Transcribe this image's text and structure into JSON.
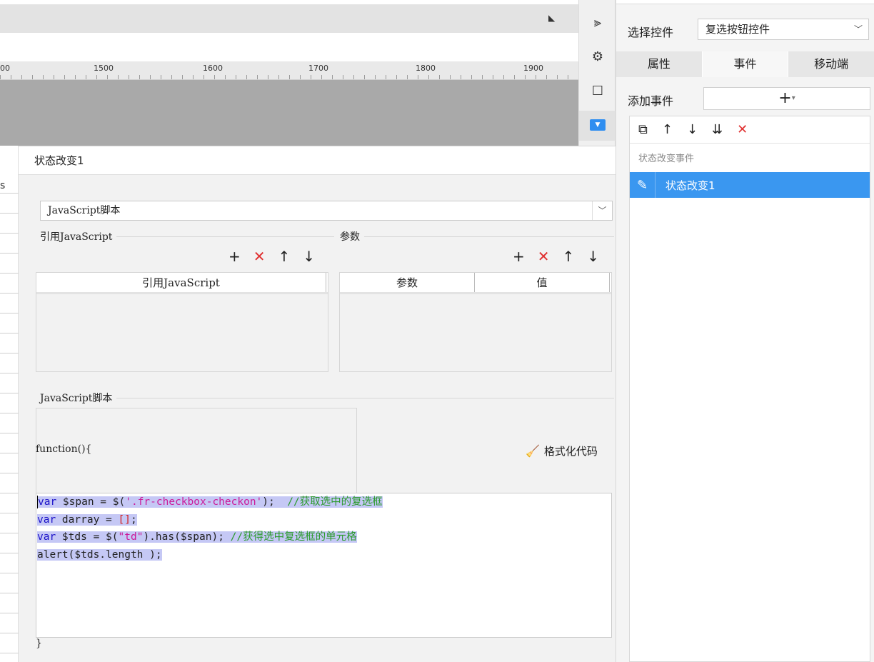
{
  "ruler": {
    "labels": [
      "00",
      "1500",
      "1600",
      "1700",
      "1800",
      "1900"
    ]
  },
  "left_strip": {
    "letter": "s"
  },
  "right_panel": {
    "select_label": "选择控件",
    "select_value": "复选按钮控件",
    "tabs": [
      {
        "label": "属性"
      },
      {
        "label": "事件"
      },
      {
        "label": "移动端"
      }
    ],
    "add_event_label": "添加事件",
    "add_event_plus": "+",
    "event_group": "状态改变事件",
    "event_item": "状态改变1"
  },
  "dialog": {
    "title": "状态改变1",
    "type_select": "JavaScript脚本",
    "ref_js_legend": "引用JavaScript",
    "ref_js_column": "引用JavaScript",
    "params_legend": "参数",
    "params_columns": [
      "参数",
      "值"
    ],
    "script_legend": "JavaScript脚本",
    "function_header": "function(){",
    "format_button": "格式化代码",
    "closing_brace": "}",
    "code": {
      "line1": {
        "kw": "var",
        "rest": " $span = $(",
        "str": "'.fr-checkbox-checkon'",
        "end": ");  ",
        "comment": "//获取选中的复选框"
      },
      "line2": {
        "kw": "var",
        "rest": " darray = ",
        "bracket": "[]",
        "end": ";"
      },
      "line3": {
        "kw": "var",
        "rest": " $tds = $(",
        "str": "\"td\"",
        "mid": ").has($span); ",
        "comment": "//获得选中复选框的单元格"
      },
      "line4": {
        "text": "alert($tds.length );"
      }
    }
  }
}
